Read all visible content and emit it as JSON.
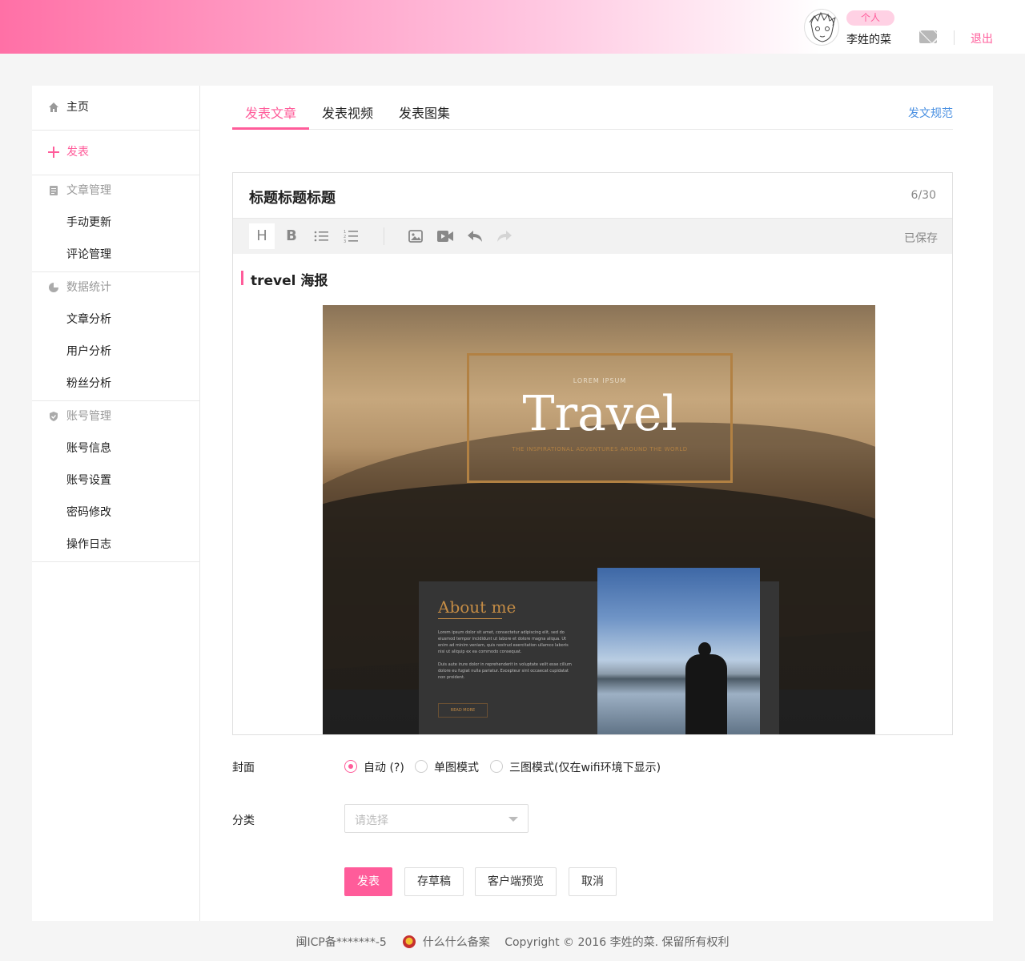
{
  "header": {
    "role_badge": "个人",
    "username": "李姓的菜",
    "logout": "退出"
  },
  "sidebar": {
    "home": "主页",
    "publish": "发表",
    "sections": [
      {
        "title": "文章管理",
        "items": [
          "手动更新",
          "评论管理"
        ]
      },
      {
        "title": "数据统计",
        "items": [
          "文章分析",
          "用户分析",
          "粉丝分析"
        ]
      },
      {
        "title": "账号管理",
        "items": [
          "账号信息",
          "账号设置",
          "密码修改",
          "操作日志"
        ]
      }
    ]
  },
  "tabs": [
    "发表文章",
    "发表视频",
    "发表图集"
  ],
  "guide_link": "发文规范",
  "editor": {
    "title": "标题标题标题",
    "counter": "6/30",
    "toolbar": {
      "heading": "H",
      "bold": "B"
    },
    "saved": "已保存",
    "heading_text": "trevel 海报",
    "poster": {
      "lorem": "LOREM IPSUM",
      "title": "Travel",
      "tagline": "THE INSPIRATIONAL ADVENTURES AROUND THE WORLD",
      "about_title": "About me",
      "about_body_1": "Lorem ipsum dolor sit amet, consectetur adipiscing elit, sed do eiusmod tempor incididunt ut labore et dolore magna aliqua. Ut enim ad minim veniam, quis nostrud exercitation ullamco laboris nisi ut aliquip ex ea commodo consequat.",
      "about_body_2": "Duis aute irure dolor in reprehenderit in voluptate velit esse cillum dolore eu fugiat nulla pariatur. Excepteur sint occaecat cupidatat non proident.",
      "read_more": "READ MORE"
    }
  },
  "form": {
    "cover_label": "封面",
    "cover_options": [
      "自动 (?)",
      "单图模式",
      "三图模式(仅在wifi环境下显示)"
    ],
    "category_label": "分类",
    "category_placeholder": "请选择",
    "buttons": {
      "publish": "发表",
      "draft": "存草稿",
      "preview": "客户端预览",
      "cancel": "取消"
    }
  },
  "footer": {
    "icp": "闽ICP备*******-5",
    "record": "什么什么备案",
    "copyright": "Copyright © 2016 李姓的菜. 保留所有权利"
  },
  "colors": {
    "accent": "#ff5c9a",
    "link": "#4a90e2"
  }
}
